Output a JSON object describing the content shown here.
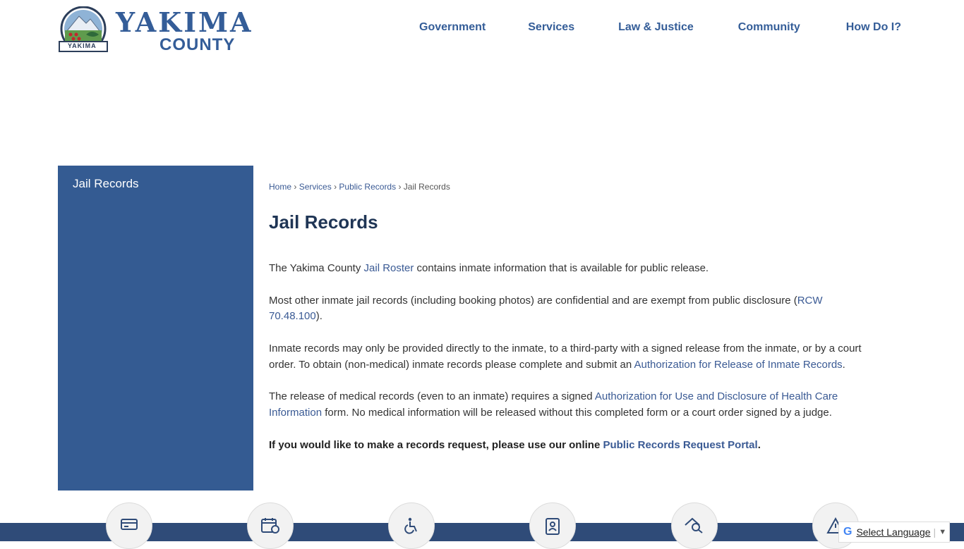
{
  "header": {
    "logo_main": "YAKIMA",
    "logo_sub": "COUNTY",
    "seal_text": "YAKIMA",
    "nav": [
      {
        "label": "Government"
      },
      {
        "label": "Services"
      },
      {
        "label": "Law & Justice"
      },
      {
        "label": "Community"
      },
      {
        "label": "How Do I?"
      }
    ]
  },
  "sidebar": {
    "title": "Jail Records"
  },
  "breadcrumb": [
    {
      "label": "Home"
    },
    {
      "label": "Services"
    },
    {
      "label": "Public Records"
    },
    {
      "label": "Jail Records"
    }
  ],
  "breadcrumb_sep": "›",
  "page_title": "Jail Records",
  "content": {
    "p1_before": "The Yakima County ",
    "p1_link": "Jail Roster",
    "p1_after": " contains inmate information that is available for public release.",
    "p2_before": "Most other inmate jail records (including booking photos) are confidential and are exempt from public disclosure (",
    "p2_link": "RCW 70.48.100",
    "p2_after": ").",
    "p3_before": "Inmate records may only be provided directly to the inmate, to a third-party with a signed release from the inmate, or by a court order.  To obtain (non-medical) inmate records please complete and submit an ",
    "p3_link": "Authorization for Release of Inmate Records",
    "p3_after": ".",
    "p4_before": "The release of medical records (even to an inmate) requires a signed ",
    "p4_link": "Authorization for Use and Disclosure of Health Care Information",
    "p4_after": " form.  No medical information will be released without this completed form or a court order signed by a judge.",
    "p5_before": "If you would like to make a records request, please use our online ",
    "p5_link": "Public Records Request Portal",
    "p5_after": "."
  },
  "footer_icons": [
    {
      "icon": "payment-card-icon"
    },
    {
      "icon": "calendar-icon"
    },
    {
      "icon": "accessibility-icon"
    },
    {
      "icon": "employee-badge-icon"
    },
    {
      "icon": "property-search-icon"
    },
    {
      "icon": "alert-icon"
    }
  ],
  "translate": {
    "g": "G",
    "label": "Select Language",
    "sep": "|",
    "arrow": "▼"
  },
  "colors": {
    "brand_blue": "#345b92",
    "footer_blue": "#2f4b78",
    "link": "#3a5a94",
    "title": "#1f3555"
  }
}
